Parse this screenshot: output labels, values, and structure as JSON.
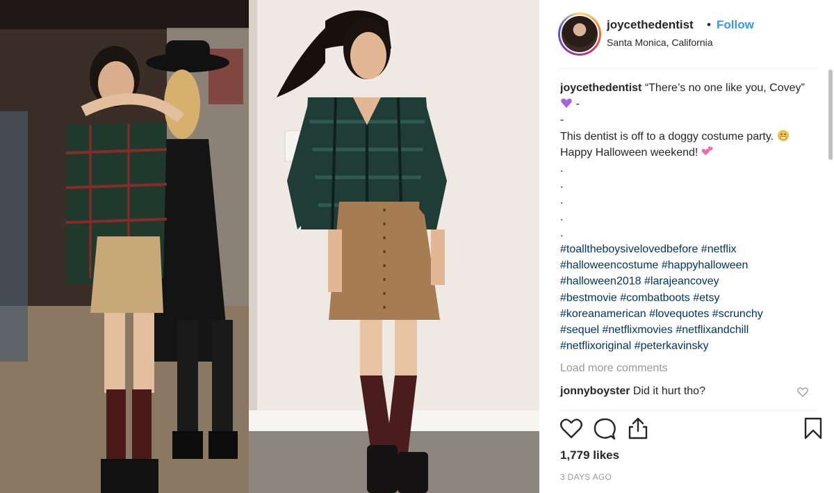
{
  "header": {
    "username": "joycethedentist",
    "separator": "•",
    "follow_label": "Follow",
    "location": "Santa Monica, California"
  },
  "caption": {
    "username": "joycethedentist",
    "line1": "“There’s no one like you, Covey”",
    "line1_suffix": " -",
    "line2": "-",
    "line3": "This dentist is off to a doggy costume party.",
    "line3_suffix": " Happy Halloween weekend!",
    "dots": [
      ".",
      ".",
      ".",
      ".",
      "."
    ],
    "hashtags": "#toalltheboysiveloved before #netflix #halloweencostume #happyhalloween #halloween2018 #larajeancovey #bestmovie #combatboots #etsy #koreanamerican #lovequotes #scrunchy #sequel #netflixmovies #netflixandchill #netflixoriginal #peterkavinsky",
    "hashtag_lines": [
      "#toalltheboysivelovedbefore #netflix",
      "#halloweencostume #happyhalloween",
      "#halloween2018 #larajeancovey",
      "#bestmovie #combatboots #etsy",
      "#koreanamerican #lovequotes #scrunchy",
      "#sequel #netflixmovies #netflixandchill",
      "#netflixoriginal #peterkavinsky"
    ]
  },
  "load_more_label": "Load more comments",
  "comment": {
    "username": "jonnyboyster",
    "text": "Did it hurt tho?"
  },
  "likes": "1,779 likes",
  "posted": "3 DAYS AGO",
  "icons": {
    "purple_heart": "purple-heart-emoji",
    "grimace": "grimacing-face-emoji",
    "two_hearts": "two-hearts-emoji",
    "like": "heart-icon",
    "comment": "comment-bubble-icon",
    "share": "share-icon",
    "save": "bookmark-icon"
  },
  "colors": {
    "follow": "#3897f0",
    "hashtag": "#003569",
    "muted": "#999999"
  }
}
